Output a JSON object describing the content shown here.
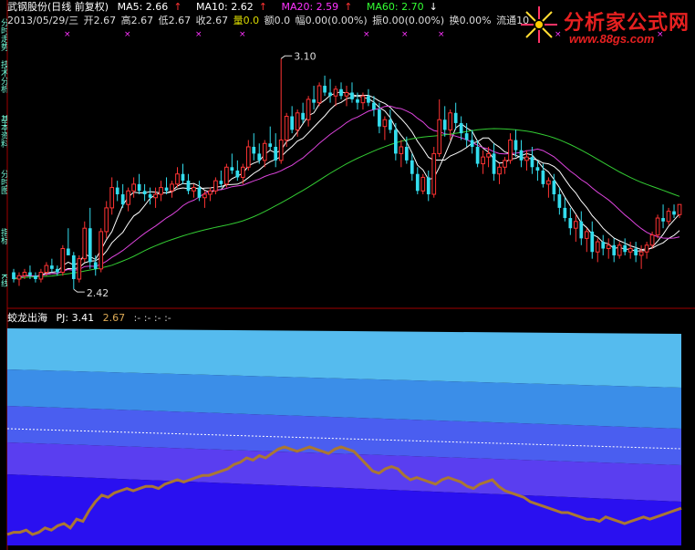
{
  "header": {
    "stock_title": "武钢股份(日线 前复权)",
    "ma_labels": [
      {
        "text": "MA5: 2.66",
        "color": "#ffffff"
      },
      {
        "text": "MA10: 2.62",
        "color": "#ffffff"
      },
      {
        "text": "MA20: 2.59",
        "color": "#ff33ff"
      },
      {
        "text": "MA60: 2.70",
        "color": "#33ff33"
      }
    ],
    "arrow_up": "↑",
    "arrow_down": "↓",
    "arrow_colors": [
      "#ff3333",
      "#ff3333",
      "#ff3333",
      "#ffffff"
    ],
    "info_line": [
      {
        "text": "2013/05/29/三",
        "color": "#dddddd"
      },
      {
        "text": "开2.67",
        "color": "#dddddd"
      },
      {
        "text": "高2.67",
        "color": "#dddddd"
      },
      {
        "text": "低2.67",
        "color": "#dddddd"
      },
      {
        "text": "收2.67",
        "color": "#dddddd"
      },
      {
        "text": "量0.0",
        "color": "#dddd00"
      },
      {
        "text": "额0.0",
        "color": "#dddddd"
      },
      {
        "text": "幅0.00(0.00%)",
        "color": "#dddddd"
      },
      {
        "text": "振0.00(0.00%)",
        "color": "#dddddd"
      },
      {
        "text": "换0.00%",
        "color": "#dddddd"
      },
      {
        "text": "流通10",
        "color": "#dddddd"
      }
    ]
  },
  "price_labels": {
    "high": "3.10",
    "low": "2.42"
  },
  "lower_panel": {
    "indicator_name": "蛟龙出海",
    "pj_label": "PJ: 3.41",
    "pj_value2": "2.67",
    "pj_rest": ":- :- :- :-"
  },
  "side_tabs": [
    "分时走势",
    "技术分析",
    "基本资料",
    "分时图",
    "指标",
    "K线"
  ],
  "logo": {
    "brand": "分析家公式网",
    "url": "www.88gs.com"
  },
  "colors": {
    "up": "#ff3333",
    "down": "#33ddee",
    "ma5": "#ffffff",
    "ma10": "#ffffff",
    "ma20": "#dd44dd",
    "ma60": "#33cc33",
    "band1": "#55bbee",
    "band2": "#3b8ee8",
    "band3": "#4a5ef0",
    "band4": "#5a3ef0",
    "band5": "#2a10f0",
    "indicator_line": "#aa7733"
  },
  "chart_data": {
    "type": "candlestick",
    "ylim": [
      2.38,
      3.16
    ],
    "annotations": {
      "high": 3.1,
      "low": 2.42
    },
    "candles": [
      [
        2.47,
        2.48,
        2.44,
        2.45
      ],
      [
        2.45,
        2.47,
        2.43,
        2.46
      ],
      [
        2.46,
        2.48,
        2.45,
        2.47
      ],
      [
        2.47,
        2.49,
        2.45,
        2.46
      ],
      [
        2.46,
        2.47,
        2.44,
        2.45
      ],
      [
        2.45,
        2.48,
        2.44,
        2.47
      ],
      [
        2.47,
        2.5,
        2.46,
        2.49
      ],
      [
        2.49,
        2.51,
        2.47,
        2.48
      ],
      [
        2.48,
        2.49,
        2.46,
        2.47
      ],
      [
        2.47,
        2.55,
        2.46,
        2.54
      ],
      [
        2.54,
        2.6,
        2.52,
        2.52
      ],
      [
        2.52,
        2.53,
        2.42,
        2.45
      ],
      [
        2.45,
        2.52,
        2.44,
        2.51
      ],
      [
        2.51,
        2.62,
        2.5,
        2.6
      ],
      [
        2.6,
        2.66,
        2.48,
        2.5
      ],
      [
        2.5,
        2.52,
        2.46,
        2.48
      ],
      [
        2.48,
        2.6,
        2.47,
        2.59
      ],
      [
        2.59,
        2.68,
        2.57,
        2.66
      ],
      [
        2.66,
        2.75,
        2.64,
        2.72
      ],
      [
        2.72,
        2.74,
        2.68,
        2.7
      ],
      [
        2.7,
        2.73,
        2.66,
        2.67
      ],
      [
        2.67,
        2.72,
        2.65,
        2.71
      ],
      [
        2.71,
        2.75,
        2.69,
        2.73
      ],
      [
        2.73,
        2.76,
        2.7,
        2.71
      ],
      [
        2.71,
        2.73,
        2.68,
        2.7
      ],
      [
        2.7,
        2.72,
        2.67,
        2.69
      ],
      [
        2.69,
        2.72,
        2.66,
        2.7
      ],
      [
        2.7,
        2.74,
        2.68,
        2.72
      ],
      [
        2.72,
        2.75,
        2.7,
        2.71
      ],
      [
        2.71,
        2.74,
        2.69,
        2.73
      ],
      [
        2.73,
        2.78,
        2.72,
        2.76
      ],
      [
        2.76,
        2.79,
        2.73,
        2.74
      ],
      [
        2.74,
        2.76,
        2.7,
        2.71
      ],
      [
        2.71,
        2.73,
        2.69,
        2.72
      ],
      [
        2.72,
        2.74,
        2.68,
        2.69
      ],
      [
        2.69,
        2.71,
        2.66,
        2.7
      ],
      [
        2.7,
        2.72,
        2.68,
        2.71
      ],
      [
        2.71,
        2.75,
        2.7,
        2.74
      ],
      [
        2.74,
        2.77,
        2.72,
        2.73
      ],
      [
        2.73,
        2.79,
        2.72,
        2.78
      ],
      [
        2.78,
        2.82,
        2.76,
        2.77
      ],
      [
        2.77,
        2.8,
        2.74,
        2.75
      ],
      [
        2.75,
        2.79,
        2.73,
        2.78
      ],
      [
        2.78,
        2.86,
        2.77,
        2.84
      ],
      [
        2.84,
        2.88,
        2.8,
        2.82
      ],
      [
        2.82,
        2.85,
        2.79,
        2.8
      ],
      [
        2.8,
        2.86,
        2.78,
        2.85
      ],
      [
        2.85,
        2.9,
        2.83,
        2.84
      ],
      [
        2.84,
        2.88,
        2.78,
        2.8
      ],
      [
        2.8,
        3.1,
        2.79,
        2.86
      ],
      [
        2.86,
        2.94,
        2.84,
        2.93
      ],
      [
        2.93,
        2.96,
        2.88,
        2.89
      ],
      [
        2.89,
        2.95,
        2.87,
        2.94
      ],
      [
        2.94,
        2.97,
        2.91,
        2.92
      ],
      [
        2.92,
        2.99,
        2.9,
        2.98
      ],
      [
        2.98,
        3.02,
        2.95,
        2.97
      ],
      [
        2.97,
        3.03,
        2.96,
        3.02
      ],
      [
        3.02,
        3.05,
        2.99,
        3.0
      ],
      [
        3.0,
        3.04,
        2.97,
        2.99
      ],
      [
        2.99,
        3.02,
        2.96,
        3.01
      ],
      [
        3.01,
        3.03,
        2.98,
        2.99
      ],
      [
        2.99,
        3.02,
        2.96,
        3.0
      ],
      [
        3.0,
        3.03,
        2.97,
        2.98
      ],
      [
        2.98,
        3.0,
        2.95,
        2.97
      ],
      [
        2.97,
        3.0,
        2.95,
        2.99
      ],
      [
        2.99,
        3.01,
        2.96,
        2.97
      ],
      [
        2.97,
        2.99,
        2.93,
        2.95
      ],
      [
        2.95,
        2.97,
        2.88,
        2.9
      ],
      [
        2.9,
        2.93,
        2.86,
        2.92
      ],
      [
        2.92,
        2.95,
        2.88,
        2.89
      ],
      [
        2.89,
        2.91,
        2.8,
        2.82
      ],
      [
        2.82,
        2.86,
        2.78,
        2.84
      ],
      [
        2.84,
        2.87,
        2.79,
        2.8
      ],
      [
        2.8,
        2.82,
        2.74,
        2.76
      ],
      [
        2.76,
        2.78,
        2.7,
        2.71
      ],
      [
        2.71,
        2.76,
        2.7,
        2.75
      ],
      [
        2.75,
        2.77,
        2.68,
        2.7
      ],
      [
        2.7,
        2.84,
        2.69,
        2.82
      ],
      [
        2.82,
        2.98,
        2.81,
        2.92
      ],
      [
        2.92,
        2.96,
        2.87,
        2.89
      ],
      [
        2.89,
        2.95,
        2.86,
        2.94
      ],
      [
        2.94,
        2.97,
        2.89,
        2.91
      ],
      [
        2.91,
        2.93,
        2.86,
        2.88
      ],
      [
        2.88,
        2.91,
        2.84,
        2.86
      ],
      [
        2.86,
        2.89,
        2.82,
        2.84
      ],
      [
        2.84,
        2.86,
        2.78,
        2.79
      ],
      [
        2.79,
        2.83,
        2.76,
        2.81
      ],
      [
        2.81,
        2.84,
        2.78,
        2.82
      ],
      [
        2.82,
        2.85,
        2.74,
        2.76
      ],
      [
        2.76,
        2.79,
        2.73,
        2.78
      ],
      [
        2.78,
        2.81,
        2.76,
        2.8
      ],
      [
        2.8,
        2.88,
        2.79,
        2.86
      ],
      [
        2.86,
        2.89,
        2.81,
        2.83
      ],
      [
        2.83,
        2.86,
        2.78,
        2.8
      ],
      [
        2.8,
        2.83,
        2.77,
        2.81
      ],
      [
        2.81,
        2.84,
        2.76,
        2.78
      ],
      [
        2.78,
        2.8,
        2.74,
        2.77
      ],
      [
        2.77,
        2.79,
        2.72,
        2.73
      ],
      [
        2.73,
        2.75,
        2.69,
        2.74
      ],
      [
        2.74,
        2.76,
        2.68,
        2.7
      ],
      [
        2.7,
        2.72,
        2.64,
        2.66
      ],
      [
        2.66,
        2.69,
        2.62,
        2.63
      ],
      [
        2.63,
        2.66,
        2.58,
        2.6
      ],
      [
        2.6,
        2.64,
        2.56,
        2.62
      ],
      [
        2.62,
        2.65,
        2.55,
        2.57
      ],
      [
        2.57,
        2.6,
        2.53,
        2.59
      ],
      [
        2.59,
        2.62,
        2.51,
        2.53
      ],
      [
        2.53,
        2.57,
        2.5,
        2.56
      ],
      [
        2.56,
        2.58,
        2.52,
        2.54
      ],
      [
        2.54,
        2.57,
        2.51,
        2.55
      ],
      [
        2.55,
        2.57,
        2.5,
        2.52
      ],
      [
        2.52,
        2.56,
        2.51,
        2.55
      ],
      [
        2.55,
        2.57,
        2.52,
        2.53
      ],
      [
        2.53,
        2.56,
        2.51,
        2.54
      ],
      [
        2.54,
        2.56,
        2.5,
        2.52
      ],
      [
        2.52,
        2.55,
        2.48,
        2.53
      ],
      [
        2.53,
        2.56,
        2.51,
        2.55
      ],
      [
        2.55,
        2.59,
        2.54,
        2.58
      ],
      [
        2.58,
        2.64,
        2.57,
        2.63
      ],
      [
        2.63,
        2.67,
        2.6,
        2.62
      ],
      [
        2.62,
        2.66,
        2.61,
        2.65
      ],
      [
        2.65,
        2.67,
        2.63,
        2.64
      ],
      [
        2.64,
        2.67,
        2.63,
        2.67
      ]
    ],
    "indicator": {
      "ylim": [
        0,
        1
      ],
      "line": [
        0.05,
        0.06,
        0.06,
        0.07,
        0.05,
        0.06,
        0.08,
        0.07,
        0.09,
        0.1,
        0.08,
        0.12,
        0.11,
        0.16,
        0.2,
        0.23,
        0.22,
        0.24,
        0.25,
        0.26,
        0.25,
        0.26,
        0.27,
        0.27,
        0.26,
        0.28,
        0.29,
        0.3,
        0.29,
        0.3,
        0.31,
        0.32,
        0.32,
        0.33,
        0.34,
        0.35,
        0.37,
        0.38,
        0.4,
        0.39,
        0.41,
        0.4,
        0.42,
        0.44,
        0.45,
        0.44,
        0.43,
        0.44,
        0.45,
        0.44,
        0.43,
        0.42,
        0.44,
        0.45,
        0.44,
        0.43,
        0.4,
        0.37,
        0.34,
        0.33,
        0.35,
        0.36,
        0.35,
        0.32,
        0.3,
        0.31,
        0.3,
        0.29,
        0.28,
        0.3,
        0.31,
        0.3,
        0.29,
        0.27,
        0.26,
        0.28,
        0.29,
        0.3,
        0.27,
        0.25,
        0.24,
        0.23,
        0.22,
        0.2,
        0.19,
        0.18,
        0.17,
        0.16,
        0.15,
        0.15,
        0.14,
        0.13,
        0.12,
        0.12,
        0.11,
        0.13,
        0.12,
        0.11,
        0.1,
        0.11,
        0.12,
        0.13,
        0.12,
        0.13,
        0.14,
        0.15,
        0.16,
        0.17
      ]
    }
  }
}
